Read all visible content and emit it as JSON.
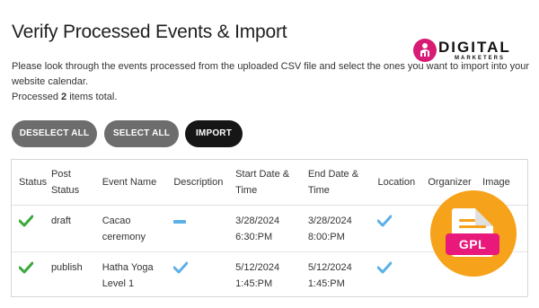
{
  "page": {
    "title": "Verify Processed Events & Import",
    "description": "Please look through the events processed from the uploaded CSV file and select the ones you want to import into your website calendar.",
    "count_prefix": "Processed ",
    "count_value": "2",
    "count_suffix": " items total."
  },
  "logo": {
    "word": "DIGITAL",
    "sub": "MARKETERS",
    "accent": "#d81b74"
  },
  "buttons": {
    "deselect": "DESELECT ALL",
    "select": "SELECT ALL",
    "import": "IMPORT"
  },
  "table": {
    "headers": {
      "status": "Status",
      "post_status_1": "Post",
      "post_status_2": "Status",
      "event_name": "Event Name",
      "description": "Description",
      "start_1": "Start Date &",
      "start_2": "Time",
      "end_1": "End Date &",
      "end_2": "Time",
      "location": "Location",
      "organizer": "Organizer",
      "image": "Image"
    },
    "rows": [
      {
        "status": "ok",
        "post_status": "draft",
        "name_1": "Cacao",
        "name_2": "ceremony",
        "description": "none",
        "start_1": "3/28/2024",
        "start_2": "6:30:PM",
        "end_1": "3/28/2024",
        "end_2": "8:00:PM",
        "location": "yes"
      },
      {
        "status": "ok",
        "post_status": "publish",
        "name_1": "Hatha Yoga",
        "name_2": "Level 1",
        "description": "yes",
        "start_1": "5/12/2024",
        "start_2": "1:45:PM",
        "end_1": "5/12/2024",
        "end_2": "1:45:PM",
        "location": "yes"
      }
    ]
  },
  "overlay": {
    "badge": "GPL"
  },
  "colors": {
    "check_green": "#3aa83a",
    "check_blue": "#5bb0e6",
    "button_gray": "#6d6d6d",
    "button_dark": "#161616",
    "gpl_orange": "#f6a21a",
    "gpl_pink": "#e8197a"
  }
}
